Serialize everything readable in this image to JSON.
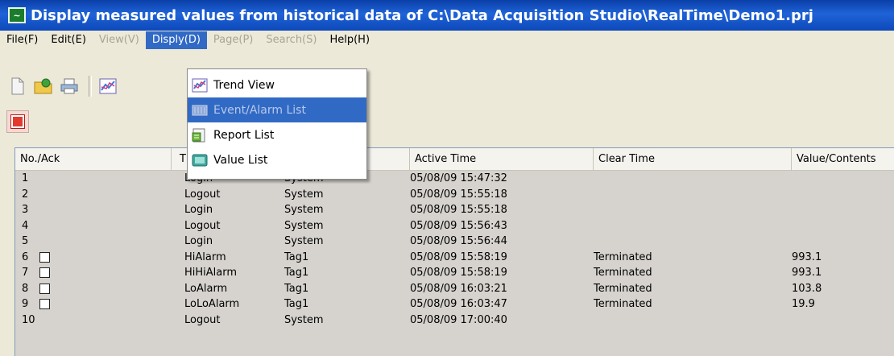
{
  "window": {
    "title": "Display measured values from historical data of C:\\Data Acquisition Studio\\RealTime\\Demo1.prj"
  },
  "menubar": {
    "items": [
      {
        "label": "File(F)",
        "state": "normal"
      },
      {
        "label": "Edit(E)",
        "state": "normal"
      },
      {
        "label": "View(V)",
        "state": "disabled"
      },
      {
        "label": "Disply(D)",
        "state": "active"
      },
      {
        "label": "Page(P)",
        "state": "disabled"
      },
      {
        "label": "Search(S)",
        "state": "disabled"
      },
      {
        "label": "Help(H)",
        "state": "normal"
      }
    ]
  },
  "dropdown": {
    "items": [
      {
        "label": "Trend View",
        "icon": "trend-view-icon"
      },
      {
        "label": "Event/Alarm List",
        "icon": "event-alarm-list-icon"
      },
      {
        "label": "Report List",
        "icon": "report-list-icon"
      },
      {
        "label": "Value List",
        "icon": "value-list-icon"
      }
    ],
    "highlighted_index": 1
  },
  "table": {
    "columns": [
      "No./Ack",
      "T",
      "",
      "Active Time",
      "Clear Time",
      "Value/Contents"
    ],
    "rows": [
      {
        "no": "1",
        "ack": false,
        "type": "Login",
        "source": "System",
        "active": "05/08/09 15:47:32",
        "clear": "",
        "value": ""
      },
      {
        "no": "2",
        "ack": false,
        "type": "Logout",
        "source": "System",
        "active": "05/08/09 15:55:18",
        "clear": "",
        "value": ""
      },
      {
        "no": "3",
        "ack": false,
        "type": "Login",
        "source": "System",
        "active": "05/08/09 15:55:18",
        "clear": "",
        "value": ""
      },
      {
        "no": "4",
        "ack": false,
        "type": "Logout",
        "source": "System",
        "active": "05/08/09 15:56:43",
        "clear": "",
        "value": ""
      },
      {
        "no": "5",
        "ack": false,
        "type": "Login",
        "source": "System",
        "active": "05/08/09 15:56:44",
        "clear": "",
        "value": ""
      },
      {
        "no": "6",
        "ack": true,
        "type": "HiAlarm",
        "source": "Tag1",
        "active": "05/08/09 15:58:19",
        "clear": "Terminated",
        "value": "993.1"
      },
      {
        "no": "7",
        "ack": true,
        "type": "HiHiAlarm",
        "source": "Tag1",
        "active": "05/08/09 15:58:19",
        "clear": "Terminated",
        "value": "993.1"
      },
      {
        "no": "8",
        "ack": true,
        "type": "LoAlarm",
        "source": "Tag1",
        "active": "05/08/09 16:03:21",
        "clear": "Terminated",
        "value": "103.8"
      },
      {
        "no": "9",
        "ack": true,
        "type": "LoLoAlarm",
        "source": "Tag1",
        "active": "05/08/09 16:03:47",
        "clear": "Terminated",
        "value": "19.9"
      },
      {
        "no": "10",
        "ack": false,
        "type": "Logout",
        "source": "System",
        "active": "05/08/09 17:00:40",
        "clear": "",
        "value": ""
      }
    ]
  },
  "colors": {
    "title_bar": "#1f63d8",
    "menu_highlight": "#316ac5",
    "grid_background": "#d6d3ce"
  }
}
